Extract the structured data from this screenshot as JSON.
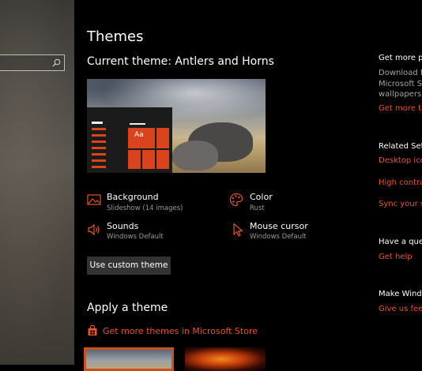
{
  "accent_color": "#e8542e",
  "sidebar": {
    "search_icon": "search-icon"
  },
  "main": {
    "page_title": "Themes",
    "current_theme_label": "Current theme: Antlers and Horns",
    "preview_tile_text": "Aa",
    "options": [
      {
        "title": "Background",
        "subtitle": "Slideshow (14 images)",
        "icon": "picture-icon"
      },
      {
        "title": "Color",
        "subtitle": "Rust",
        "icon": "palette-icon"
      },
      {
        "title": "Sounds",
        "subtitle": "Windows Default",
        "icon": "speaker-icon"
      },
      {
        "title": "Mouse cursor",
        "subtitle": "Windows Default",
        "icon": "cursor-icon"
      }
    ],
    "custom_theme_button": "Use custom theme",
    "apply_heading": "Apply a theme",
    "store_link": "Get more themes in Microsoft Store"
  },
  "right_panel": {
    "get_more_heading": "Get more pe",
    "get_more_lines": [
      "Download f",
      "Microsoft St",
      "wallpapers, s"
    ],
    "get_more_link": "Get more th",
    "related_heading": "Related Sett",
    "related_links": [
      "Desktop ico",
      "High contras",
      "Sync your se"
    ],
    "question_heading": "Have a ques",
    "question_link": "Get help",
    "make_heading": "Make Windo",
    "make_link": "Give us feed"
  }
}
